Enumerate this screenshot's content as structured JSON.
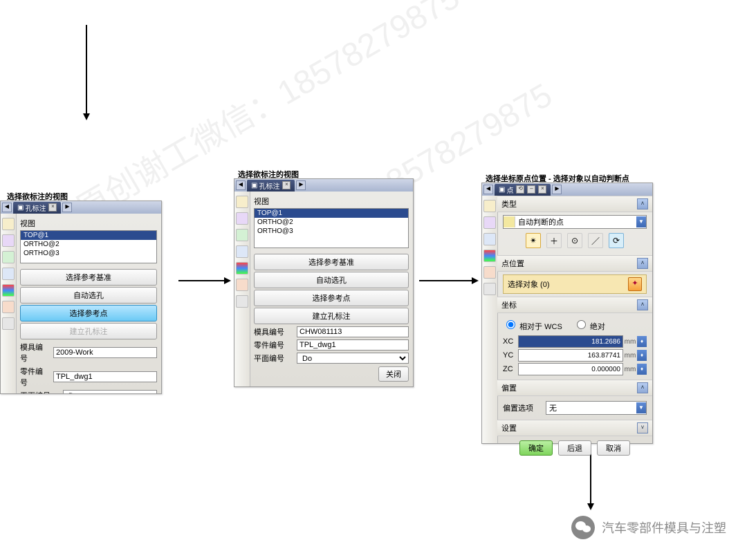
{
  "titles": {
    "p1": "选择欲标注的视图",
    "p2": "选择欲标注的视图",
    "p3": "选择坐标原点位置 - 选择对象以自动判断点"
  },
  "tab": "孔标注",
  "tab3": "点",
  "views_label": "视图",
  "views": [
    "TOP@1",
    "ORTHO@2",
    "ORTHO@3"
  ],
  "buttons": {
    "ref_datum": "选择参考基准",
    "auto_hole": "自动选孔",
    "ref_point": "选择参考点",
    "build": "建立孔标注"
  },
  "labels": {
    "mold_no": "模具编号",
    "part_no": "零件编号",
    "plane_no": "平面编号",
    "close": "关闭"
  },
  "p1vals": {
    "mold": "2009-Work",
    "part": "TPL_dwg1",
    "plane": "Do"
  },
  "p2vals": {
    "mold": "CHW081113",
    "part": "TPL_dwg1",
    "plane": "Do"
  },
  "p3": {
    "sect_type": "类型",
    "type_opt": "自动判断的点",
    "sect_pointloc": "点位置",
    "select_obj": "选择对象 (0)",
    "sect_coord": "坐标",
    "rel": "相对于 WCS",
    "abs": "绝对",
    "xc": "XC",
    "yc": "YC",
    "zc": "ZC",
    "xc_v": "181.2686",
    "yc_v": "163.87741",
    "zc_v": "0.000000",
    "unit": "mm",
    "sect_offset": "偏置",
    "offset_opt": "偏置选项",
    "offset_none": "无",
    "sect_set": "设置",
    "ok": "确定",
    "back": "后退",
    "cancel": "取消"
  },
  "wechat": "汽车零部件模具与注塑"
}
